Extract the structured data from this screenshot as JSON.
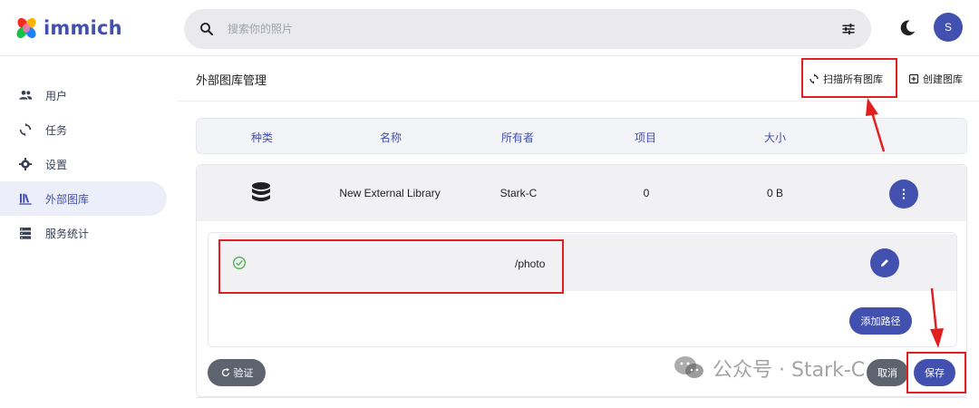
{
  "app": {
    "name": "immich"
  },
  "search": {
    "placeholder": "搜索你的照片"
  },
  "user": {
    "initial": "S"
  },
  "sidebar": {
    "items": [
      {
        "label": "用户",
        "icon": "users-icon"
      },
      {
        "label": "任务",
        "icon": "sync-icon"
      },
      {
        "label": "设置",
        "icon": "gear-icon"
      },
      {
        "label": "外部图库",
        "icon": "library-books-icon",
        "active": true
      },
      {
        "label": "服务统计",
        "icon": "server-icon"
      }
    ]
  },
  "page": {
    "title": "外部图库管理",
    "scan_all_label": "扫描所有图库",
    "create_label": "创建图库"
  },
  "table": {
    "headers": [
      "种类",
      "名称",
      "所有者",
      "项目",
      "大小"
    ],
    "rows": [
      {
        "type_icon": "database-icon",
        "name": "New External Library",
        "owner": "Stark-C",
        "items": "0",
        "size": "0 B"
      }
    ]
  },
  "library_editor": {
    "paths": [
      "/photo"
    ],
    "add_path_label": "添加路径",
    "verify_label": "验证",
    "cancel_label": "取消",
    "save_label": "保存"
  },
  "watermark": {
    "text": "公众号 · Stark-C"
  },
  "colors": {
    "primary": "#4250af",
    "secondary_button": "#5d6470",
    "annotation_red": "#e02020",
    "success": "#4caf50"
  }
}
